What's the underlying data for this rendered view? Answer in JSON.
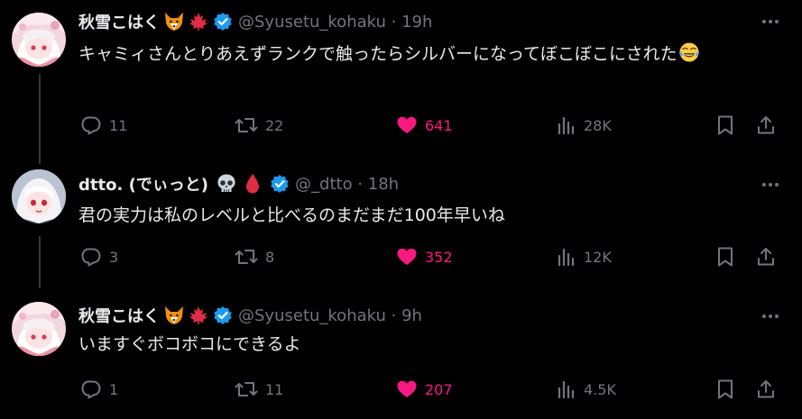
{
  "tweets": [
    {
      "name": "秋雪こはく",
      "name_emoji": [
        "fox-icon",
        "maple-leaf-icon"
      ],
      "handle": "@Syusetu_kohaku",
      "time": "19h",
      "text": "キャミィさんとりあえずランクで触ったらシルバーになってぼこぼこにされた",
      "text_emoji": "tears-of-joy-icon",
      "replies": "11",
      "reposts": "22",
      "likes": "641",
      "views": "28K"
    },
    {
      "name": "dtto. (でぃっと)",
      "name_emoji": [
        "skull-icon",
        "blood-drop-icon"
      ],
      "handle": "@_dtto",
      "time": "18h",
      "text": "君の実力は私のレベルと比べるのまだまだ100年早いね",
      "replies": "3",
      "reposts": "8",
      "likes": "352",
      "views": "12K"
    },
    {
      "name": "秋雪こはく",
      "name_emoji": [
        "fox-icon",
        "maple-leaf-icon"
      ],
      "handle": "@Syusetu_kohaku",
      "time": "9h",
      "text": "いますぐボコボコにできるよ",
      "replies": "1",
      "reposts": "11",
      "likes": "207",
      "views": "4.5K"
    }
  ],
  "sep": " · ",
  "colors": {
    "background": "#000000",
    "text": "#e7e9ea",
    "muted": "#71767b",
    "like": "#f91880",
    "verified": "#1d9bf0"
  }
}
